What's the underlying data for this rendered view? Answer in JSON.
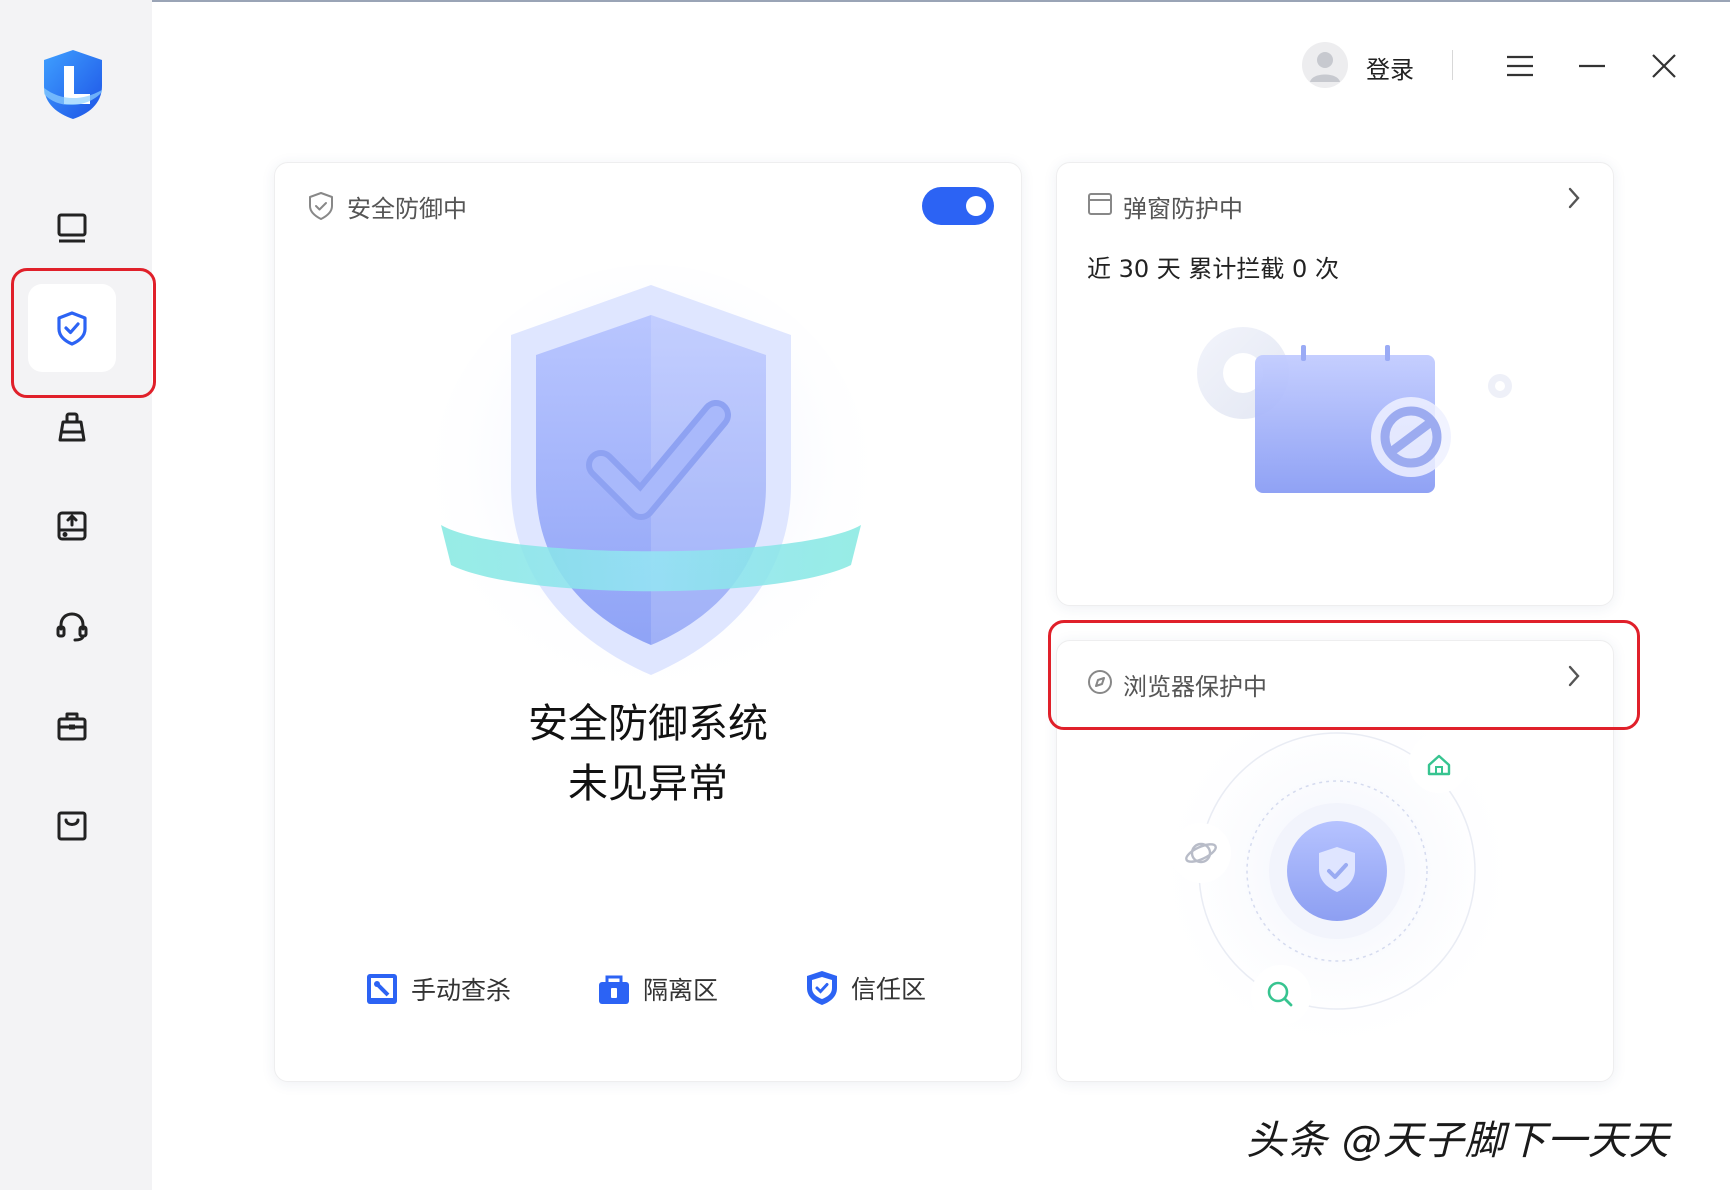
{
  "topbar": {
    "login_label": "登录"
  },
  "sidebar": {
    "items": [
      {
        "icon": "monitor-icon"
      },
      {
        "icon": "shield-check-icon",
        "active": true
      },
      {
        "icon": "broom-icon"
      },
      {
        "icon": "disk-upload-icon"
      },
      {
        "icon": "headset-icon"
      },
      {
        "icon": "toolbox-icon"
      },
      {
        "icon": "shopping-bag-icon"
      }
    ]
  },
  "defense_card": {
    "title": "安全防御中",
    "toggle_on": true,
    "status_line1": "安全防御系统",
    "status_line2": "未见异常",
    "actions": [
      {
        "label": "手动查杀",
        "icon": "manual-scan-icon"
      },
      {
        "label": "隔离区",
        "icon": "quarantine-icon"
      },
      {
        "label": "信任区",
        "icon": "trust-zone-icon"
      }
    ]
  },
  "popup_card": {
    "title": "弹窗防护中",
    "stat": "近 30 天 累计拦截 0 次"
  },
  "browser_card": {
    "title": "浏览器保护中"
  },
  "watermark": "头条 @天子脚下一天天",
  "colors": {
    "accent": "#2c63f4",
    "highlight": "#e0202a",
    "sidebar_bg": "#f3f3f5"
  }
}
